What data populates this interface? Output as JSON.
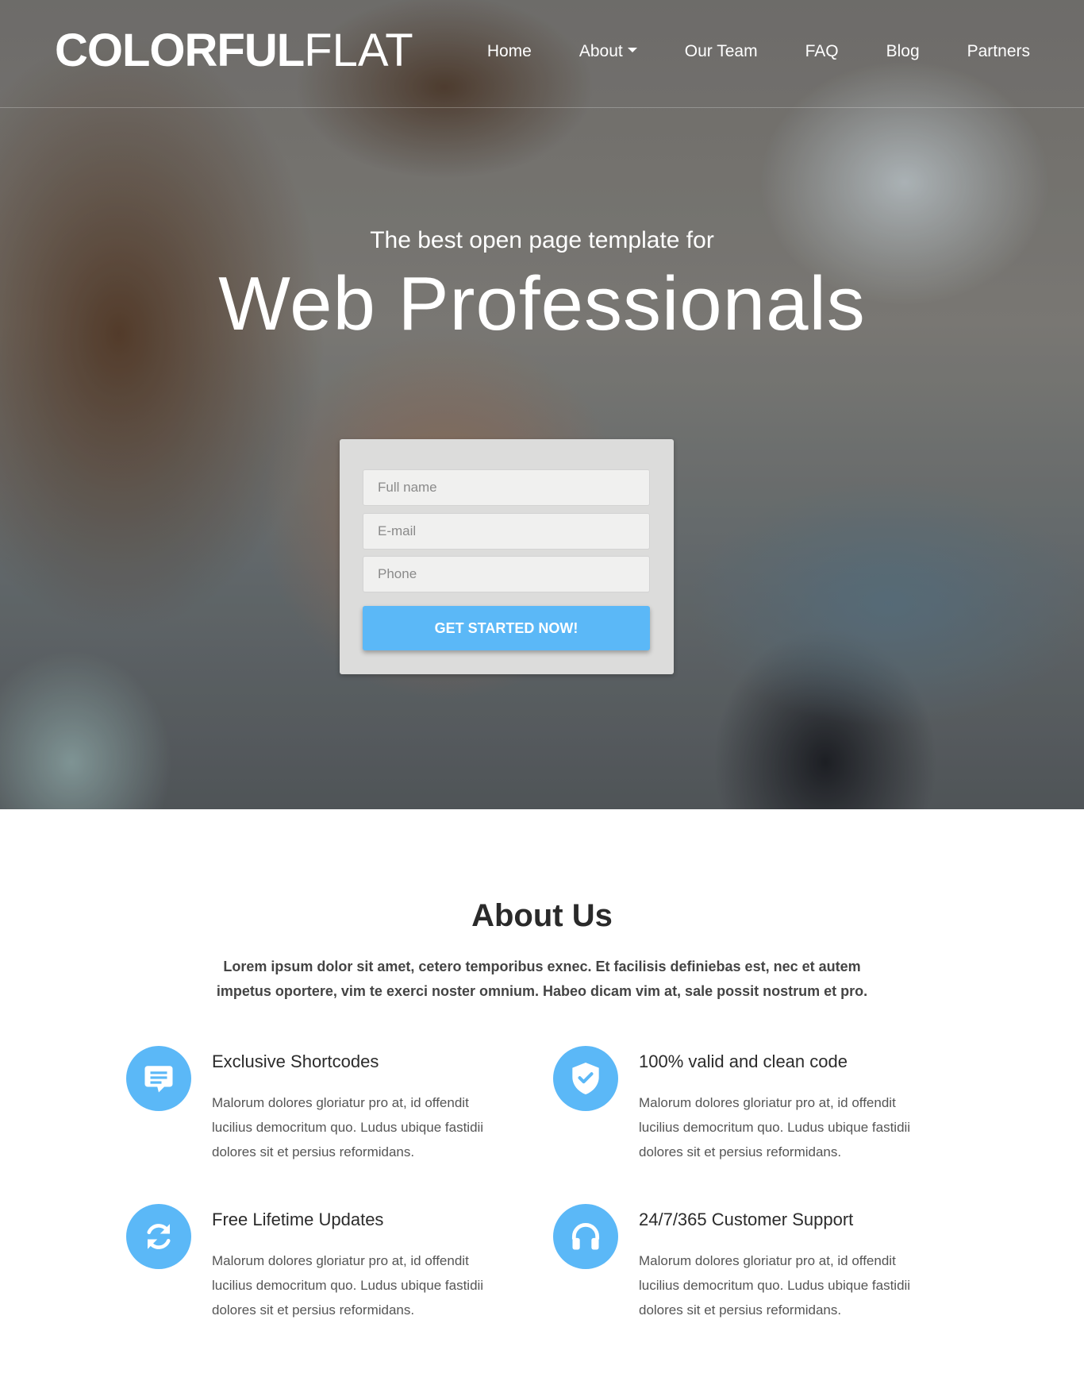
{
  "brand": {
    "bold": "COLORFUL",
    "light": "FLAT"
  },
  "nav": {
    "items": [
      {
        "label": "Home"
      },
      {
        "label": "About"
      },
      {
        "label": "Our Team"
      },
      {
        "label": "FAQ"
      },
      {
        "label": "Blog"
      },
      {
        "label": "Partners"
      }
    ]
  },
  "hero": {
    "subtitle": "The best open page template for",
    "title": "Web Professionals"
  },
  "form": {
    "fullname_placeholder": "Full name",
    "email_placeholder": "E-mail",
    "phone_placeholder": "Phone",
    "submit_label": "GET STARTED NOW!"
  },
  "about": {
    "title": "About Us",
    "lead": "Lorem ipsum dolor sit amet, cetero temporibus exnec. Et facilisis definiebas est, nec et autem impetus oportere, vim te exerci noster omnium. Habeo dicam vim at, sale possit nostrum et pro.",
    "features": [
      {
        "icon": "chat-icon",
        "title": "Exclusive Shortcodes",
        "text": "Malorum dolores gloriatur pro at, id offendit lucilius democritum quo. Ludus ubique fastidii dolores sit et persius reformidans."
      },
      {
        "icon": "shield-check-icon",
        "title": "100% valid and clean code",
        "text": "Malorum dolores gloriatur pro at, id offendit lucilius democritum quo. Ludus ubique fastidii dolores sit et persius reformidans."
      },
      {
        "icon": "refresh-icon",
        "title": "Free Lifetime Updates",
        "text": "Malorum dolores gloriatur pro at, id offendit lucilius democritum quo. Ludus ubique fastidii dolores sit et persius reformidans."
      },
      {
        "icon": "headphones-icon",
        "title": "24/7/365 Customer Support",
        "text": "Malorum dolores gloriatur pro at, id offendit lucilius democritum quo. Ludus ubique fastidii dolores sit et persius reformidans."
      }
    ]
  },
  "colors": {
    "accent": "#5bb8f7",
    "form_bg": "#dcdcdb",
    "text_dark": "#2a2a2a"
  }
}
